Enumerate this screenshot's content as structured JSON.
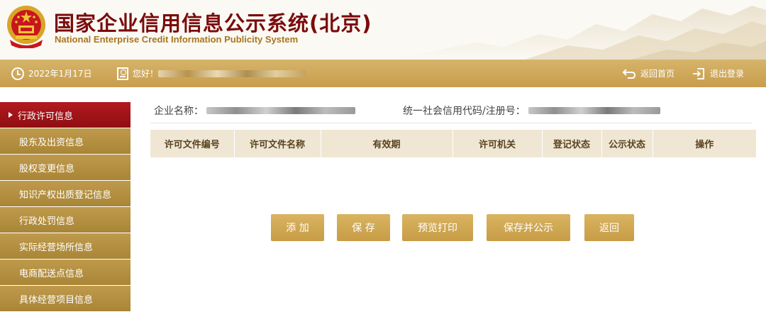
{
  "header": {
    "title_cn": "国家企业信用信息公示系统(北京)",
    "title_en": "National Enterprise Credit Information Publicity System",
    "emblem_icon": "national-emblem-icon"
  },
  "topbar": {
    "date": "2022年1月17日",
    "greeting": "您好！",
    "home_label": "返回首页",
    "logout_label": "退出登录"
  },
  "sidebar": {
    "items": [
      {
        "label": "行政许可信息",
        "active": true
      },
      {
        "label": "股东及出资信息"
      },
      {
        "label": "股权变更信息"
      },
      {
        "label": "知识产权出质登记信息"
      },
      {
        "label": "行政处罚信息"
      },
      {
        "label": "实际经营场所信息"
      },
      {
        "label": "电商配送点信息"
      },
      {
        "label": "具体经营项目信息"
      }
    ]
  },
  "main": {
    "company_label": "企业名称：",
    "credit_code_label": "统一社会信用代码/注册号：",
    "table_headers": [
      "许可文件编号",
      "许可文件名称",
      "有效期",
      "许可机关",
      "登记状态",
      "公示状态",
      "操作"
    ]
  },
  "buttons": {
    "add": "添 加",
    "save": "保 存",
    "preview_print": "预览打印",
    "save_publish": "保存并公示",
    "back": "返回"
  },
  "colors": {
    "gold": "#c89d4d",
    "active_red": "#a8151a",
    "title_red": "#7a0c0c",
    "table_header_bg": "#efe7d3"
  }
}
